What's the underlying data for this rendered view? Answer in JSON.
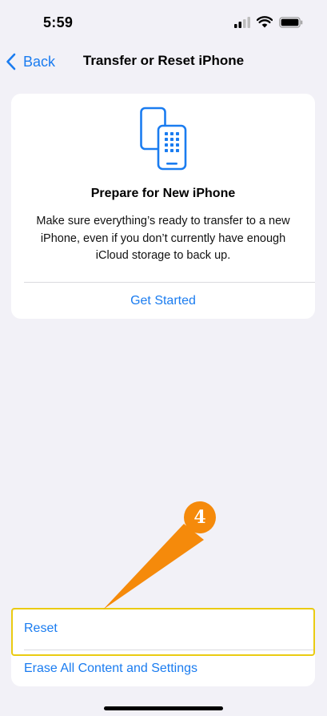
{
  "status_bar": {
    "time": "5:59",
    "icons": [
      "signal-icon",
      "wifi-icon",
      "battery-icon"
    ]
  },
  "nav": {
    "back_label": "Back",
    "title": "Transfer or Reset iPhone"
  },
  "prepare_card": {
    "icon": "devices-transfer-icon",
    "title": "Prepare for New iPhone",
    "body": "Make sure everything’s ready to transfer to a new iPhone, even if you don’t currently have enough iCloud storage to back up.",
    "action_label": "Get Started"
  },
  "bottom_list": {
    "items": [
      {
        "label": "Reset"
      },
      {
        "label": "Erase All Content and Settings"
      }
    ]
  },
  "annotation": {
    "step_number": "4",
    "callout_color": "#F58A0B",
    "highlight_color": "#EACB12"
  },
  "colors": {
    "accent": "#1A7CF0",
    "background": "#F2F1F7",
    "card": "#FFFFFF"
  }
}
